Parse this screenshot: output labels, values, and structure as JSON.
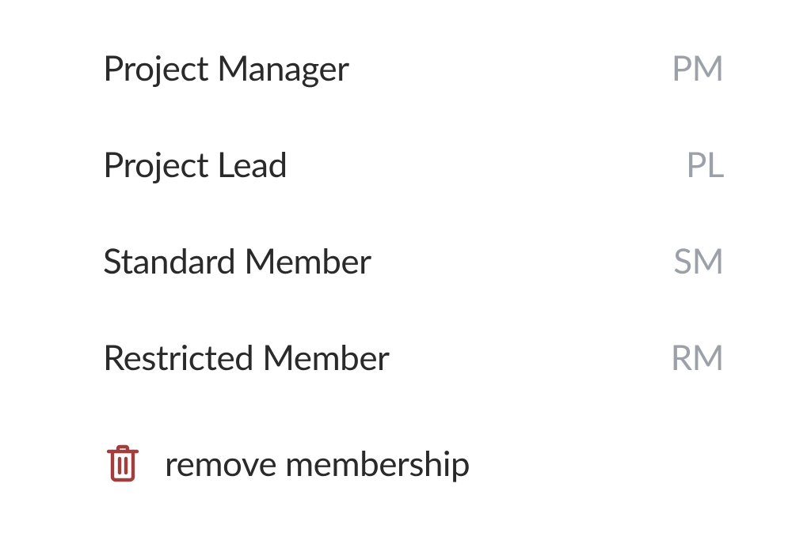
{
  "roles": [
    {
      "label": "Project Manager",
      "abbr": "PM"
    },
    {
      "label": "Project Lead",
      "abbr": "PL"
    },
    {
      "label": "Standard Member",
      "abbr": "SM"
    },
    {
      "label": "Restricted Member",
      "abbr": "RM"
    }
  ],
  "remove": {
    "label": "remove membership"
  },
  "colors": {
    "trash": "#a13f3f"
  }
}
